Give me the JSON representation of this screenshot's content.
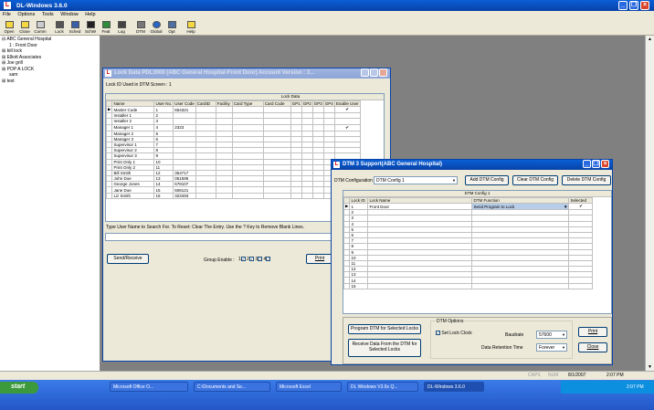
{
  "app": {
    "title": "DL-Windows 3.6.0",
    "icon": "L"
  },
  "menu": [
    "File",
    "Options",
    "Tools",
    "Window",
    "Help"
  ],
  "toolbar": [
    "Open",
    "Close",
    "Comm",
    "Lock",
    "Sched",
    "SchW",
    "Feat",
    "Log",
    "DTM",
    "Global",
    "Opt",
    "Help"
  ],
  "tree": [
    "ABC General Hospital",
    "1 : Front Door",
    "bill lock",
    "Elliott Associates",
    "Joe grill",
    "POP A LOCK",
    "sam",
    "test"
  ],
  "lockdata": {
    "title": "Lock Data PDL3000 (ABC General Hospital-Front Door)      Account Version : 3...",
    "lock_id_label": "Lock ID Used in DTM Screen : 1",
    "grid_header": "Lock Data",
    "columns": [
      "Name",
      "User No.",
      "User Code",
      "CardID",
      "Facility",
      "Card Type",
      "Card Code",
      "GP1",
      "GP2",
      "GP3",
      "GP4",
      "Enable User"
    ],
    "rows": [
      [
        "Master Code",
        "1",
        "654321",
        "✔"
      ],
      [
        "Installer 1",
        "2",
        "",
        ""
      ],
      [
        "Installer 2",
        "3",
        "",
        ""
      ],
      [
        "Manager 1",
        "4",
        "2323",
        "✔"
      ],
      [
        "Manager 2",
        "5",
        "",
        ""
      ],
      [
        "Manager 3",
        "6",
        "",
        ""
      ],
      [
        "Supervisor 1",
        "7",
        "",
        ""
      ],
      [
        "Supervisor 2",
        "8",
        "",
        ""
      ],
      [
        "Supervisor 3",
        "9",
        "",
        ""
      ],
      [
        "Print Only 1",
        "10",
        "",
        ""
      ],
      [
        "Print Only 2",
        "11",
        "",
        ""
      ],
      [
        "Bill Smith",
        "12",
        "354717",
        ""
      ],
      [
        "John Doe",
        "13",
        "051595",
        ""
      ],
      [
        "George Jones",
        "14",
        "678107",
        ""
      ],
      [
        "Jane Doe",
        "15",
        "508121",
        ""
      ],
      [
        "Liz Smith",
        "16",
        "323493",
        ""
      ]
    ],
    "hint": "Type User Name to Search For. To Reset: Clear The Entry. Use the ? Key to Remove Blank Lines.",
    "send_receive": "Send/Receive",
    "group_enable": "Group Enable :",
    "groups": [
      "1",
      "2",
      "3",
      "4"
    ],
    "print": "Print"
  },
  "dtm": {
    "title": "DTM 3 Support(ABC General Hospital)",
    "config_label": "DTM Configuration",
    "config_value": "DTM Config 1",
    "add": "Add DTM Config",
    "clear": "Clear DTM Config",
    "delete": "Delete DTM Config",
    "grid_header": "DTM Config 1",
    "columns": [
      "Lock ID",
      "Lock Name",
      "DTM Function",
      "Selected"
    ],
    "first_row": {
      "id": "1",
      "name": "Front Door",
      "function": "Send Program to Lock",
      "selected": "✔"
    },
    "row_ids": [
      "2",
      "3",
      "4",
      "5",
      "6",
      "7",
      "8",
      "9",
      "10",
      "11",
      "12",
      "13",
      "14",
      "15"
    ],
    "program_btn": "Program DTM for Selected Locks",
    "receive_btn": "Receive Data From the DTM for Selected Locks",
    "options_label": "DTM Options",
    "set_clock": "Set Lock Clock",
    "baudrate_label": "Baudrate",
    "baudrate": "57600",
    "retention_label": "Data Retention Time",
    "retention": "Forever",
    "print": "Print",
    "close": "Close"
  },
  "status": {
    "caps": "CAPS",
    "num": "NUM",
    "date": "8/1/2007",
    "time": "2:07 PM"
  },
  "taskbar": {
    "start": "start",
    "tasks": [
      "Microsoft Office O...",
      "C:\\Documents and Se...",
      "Microsoft Excel",
      "DL Windows V3.6x Q...",
      "DL-Windows 3.6.0"
    ],
    "clock": "2:07 PM"
  },
  "colors": {
    "title_blue": "#0842a8",
    "mdi_gray": "#808080",
    "xp_face": "#ece9d8",
    "selection": "#316ac5"
  }
}
